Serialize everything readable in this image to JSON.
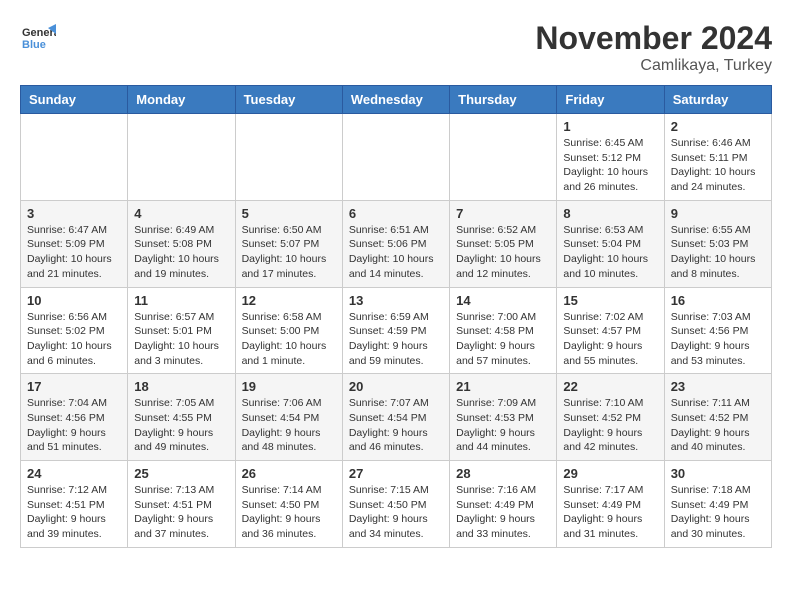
{
  "logo": {
    "line1": "General",
    "line2": "Blue"
  },
  "title": "November 2024",
  "location": "Camlikaya, Turkey",
  "days_header": [
    "Sunday",
    "Monday",
    "Tuesday",
    "Wednesday",
    "Thursday",
    "Friday",
    "Saturday"
  ],
  "weeks": [
    [
      {
        "day": "",
        "info": ""
      },
      {
        "day": "",
        "info": ""
      },
      {
        "day": "",
        "info": ""
      },
      {
        "day": "",
        "info": ""
      },
      {
        "day": "",
        "info": ""
      },
      {
        "day": "1",
        "info": "Sunrise: 6:45 AM\nSunset: 5:12 PM\nDaylight: 10 hours and 26 minutes."
      },
      {
        "day": "2",
        "info": "Sunrise: 6:46 AM\nSunset: 5:11 PM\nDaylight: 10 hours and 24 minutes."
      }
    ],
    [
      {
        "day": "3",
        "info": "Sunrise: 6:47 AM\nSunset: 5:09 PM\nDaylight: 10 hours and 21 minutes."
      },
      {
        "day": "4",
        "info": "Sunrise: 6:49 AM\nSunset: 5:08 PM\nDaylight: 10 hours and 19 minutes."
      },
      {
        "day": "5",
        "info": "Sunrise: 6:50 AM\nSunset: 5:07 PM\nDaylight: 10 hours and 17 minutes."
      },
      {
        "day": "6",
        "info": "Sunrise: 6:51 AM\nSunset: 5:06 PM\nDaylight: 10 hours and 14 minutes."
      },
      {
        "day": "7",
        "info": "Sunrise: 6:52 AM\nSunset: 5:05 PM\nDaylight: 10 hours and 12 minutes."
      },
      {
        "day": "8",
        "info": "Sunrise: 6:53 AM\nSunset: 5:04 PM\nDaylight: 10 hours and 10 minutes."
      },
      {
        "day": "9",
        "info": "Sunrise: 6:55 AM\nSunset: 5:03 PM\nDaylight: 10 hours and 8 minutes."
      }
    ],
    [
      {
        "day": "10",
        "info": "Sunrise: 6:56 AM\nSunset: 5:02 PM\nDaylight: 10 hours and 6 minutes."
      },
      {
        "day": "11",
        "info": "Sunrise: 6:57 AM\nSunset: 5:01 PM\nDaylight: 10 hours and 3 minutes."
      },
      {
        "day": "12",
        "info": "Sunrise: 6:58 AM\nSunset: 5:00 PM\nDaylight: 10 hours and 1 minute."
      },
      {
        "day": "13",
        "info": "Sunrise: 6:59 AM\nSunset: 4:59 PM\nDaylight: 9 hours and 59 minutes."
      },
      {
        "day": "14",
        "info": "Sunrise: 7:00 AM\nSunset: 4:58 PM\nDaylight: 9 hours and 57 minutes."
      },
      {
        "day": "15",
        "info": "Sunrise: 7:02 AM\nSunset: 4:57 PM\nDaylight: 9 hours and 55 minutes."
      },
      {
        "day": "16",
        "info": "Sunrise: 7:03 AM\nSunset: 4:56 PM\nDaylight: 9 hours and 53 minutes."
      }
    ],
    [
      {
        "day": "17",
        "info": "Sunrise: 7:04 AM\nSunset: 4:56 PM\nDaylight: 9 hours and 51 minutes."
      },
      {
        "day": "18",
        "info": "Sunrise: 7:05 AM\nSunset: 4:55 PM\nDaylight: 9 hours and 49 minutes."
      },
      {
        "day": "19",
        "info": "Sunrise: 7:06 AM\nSunset: 4:54 PM\nDaylight: 9 hours and 48 minutes."
      },
      {
        "day": "20",
        "info": "Sunrise: 7:07 AM\nSunset: 4:54 PM\nDaylight: 9 hours and 46 minutes."
      },
      {
        "day": "21",
        "info": "Sunrise: 7:09 AM\nSunset: 4:53 PM\nDaylight: 9 hours and 44 minutes."
      },
      {
        "day": "22",
        "info": "Sunrise: 7:10 AM\nSunset: 4:52 PM\nDaylight: 9 hours and 42 minutes."
      },
      {
        "day": "23",
        "info": "Sunrise: 7:11 AM\nSunset: 4:52 PM\nDaylight: 9 hours and 40 minutes."
      }
    ],
    [
      {
        "day": "24",
        "info": "Sunrise: 7:12 AM\nSunset: 4:51 PM\nDaylight: 9 hours and 39 minutes."
      },
      {
        "day": "25",
        "info": "Sunrise: 7:13 AM\nSunset: 4:51 PM\nDaylight: 9 hours and 37 minutes."
      },
      {
        "day": "26",
        "info": "Sunrise: 7:14 AM\nSunset: 4:50 PM\nDaylight: 9 hours and 36 minutes."
      },
      {
        "day": "27",
        "info": "Sunrise: 7:15 AM\nSunset: 4:50 PM\nDaylight: 9 hours and 34 minutes."
      },
      {
        "day": "28",
        "info": "Sunrise: 7:16 AM\nSunset: 4:49 PM\nDaylight: 9 hours and 33 minutes."
      },
      {
        "day": "29",
        "info": "Sunrise: 7:17 AM\nSunset: 4:49 PM\nDaylight: 9 hours and 31 minutes."
      },
      {
        "day": "30",
        "info": "Sunrise: 7:18 AM\nSunset: 4:49 PM\nDaylight: 9 hours and 30 minutes."
      }
    ]
  ]
}
